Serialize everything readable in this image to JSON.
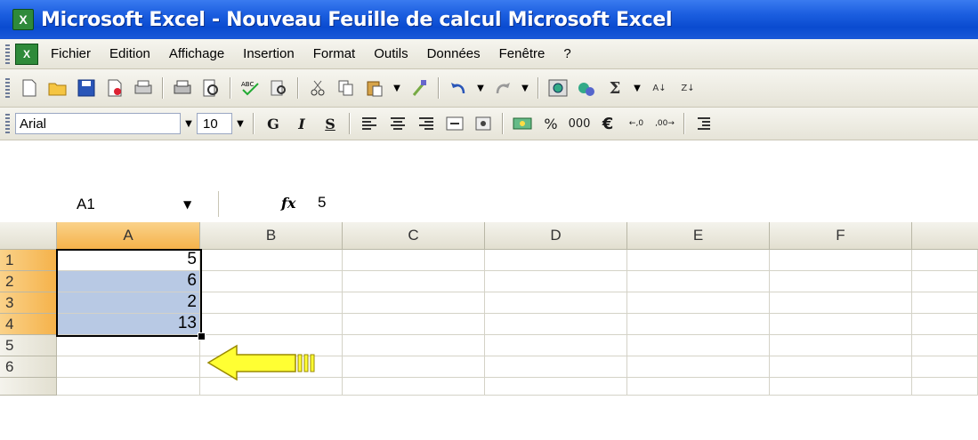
{
  "window": {
    "title": "Microsoft Excel - Nouveau Feuille de calcul Microsoft Excel"
  },
  "menu": {
    "items": [
      "Fichier",
      "Edition",
      "Affichage",
      "Insertion",
      "Format",
      "Outils",
      "Données",
      "Fenêtre",
      "?"
    ]
  },
  "format_toolbar": {
    "font": "Arial",
    "size": "10",
    "bold": "G",
    "italic": "I",
    "underline": "S",
    "percent": "%",
    "thousands": "000",
    "euro": "€"
  },
  "formula_bar": {
    "name_box": "A1",
    "fx": "fx",
    "value": "5"
  },
  "grid": {
    "columns": [
      "A",
      "B",
      "C",
      "D",
      "E",
      "F"
    ],
    "rows": [
      "1",
      "2",
      "3",
      "4",
      "5",
      "6"
    ],
    "cells": {
      "A1": "5",
      "A2": "6",
      "A3": "2",
      "A4": "13"
    }
  },
  "colors": {
    "titlebar": "#0a4bd0",
    "selection_header": "#f5b24a",
    "selected_cells": "#b8c9e4",
    "arrow": "#ffff00"
  }
}
